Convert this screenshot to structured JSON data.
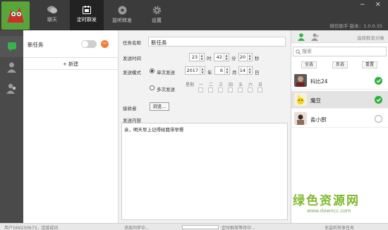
{
  "nav": {
    "tabs": [
      {
        "label": "聊天"
      },
      {
        "label": "定时群发"
      },
      {
        "label": "监听转发"
      },
      {
        "label": "设置"
      }
    ],
    "version_text": "微信助手 版本：1.0.0.35"
  },
  "tasks": {
    "items": [
      {
        "name": "新任务"
      }
    ],
    "new_label": "+ 新建"
  },
  "form": {
    "task_name_label": "任务名称",
    "task_name_value": "新任务",
    "send_time_label": "发送时间",
    "hour": "23",
    "hour_unit": "时",
    "minute": "42",
    "minute_unit": "分",
    "second": "20",
    "second_unit": "秒",
    "send_mode_label": "发送模式",
    "single_label": "单次发送",
    "multi_label": "多次发送",
    "year": "2017",
    "year_unit": "年",
    "month": "6",
    "month_unit": "月",
    "day": "14",
    "day_unit": "日",
    "week_label": "星期",
    "weekdays": [
      "一",
      "二",
      "三",
      "四",
      "五",
      "六",
      "日"
    ],
    "receiver_label": "接收者",
    "browse_label": "浏览...",
    "content_label": "发送内容",
    "content_value": "亲，明天早上记得给我带早餐"
  },
  "right": {
    "select_target_label": "选择群发对象",
    "search_placeholder": "搜索",
    "select_all": "全选",
    "invert": "反选",
    "reset": "重置",
    "contacts": [
      {
        "name": "科比24",
        "checked": true
      },
      {
        "name": "魔豆",
        "checked": true
      },
      {
        "name": "盐小厨",
        "checked": false
      }
    ]
  },
  "watermark": {
    "main": "绿色资源网",
    "url": "www.downcc.com"
  },
  "status": {
    "user": "用户569230673，连接成功",
    "sync": "消息同步中...",
    "timer": "定时群发等待中...",
    "forward": "无监听转发任务"
  },
  "colors": {
    "accent_green": "#2db13d",
    "delete_orange": "#f07d3a",
    "topbar": "#3b3b3b"
  }
}
